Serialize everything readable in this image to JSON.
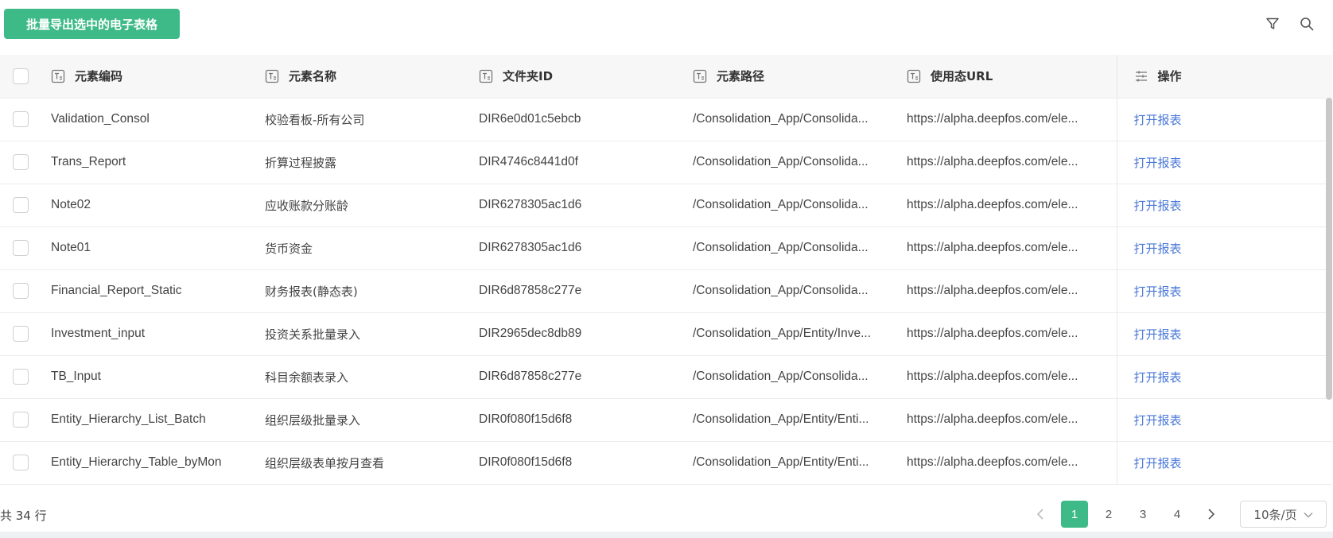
{
  "toolbar": {
    "export_label": "批量导出选中的电子表格",
    "filter_icon": "filter-icon",
    "search_icon": "search-icon"
  },
  "table": {
    "columns": [
      {
        "label": "元素编码",
        "icon": "text-column-icon"
      },
      {
        "label": "元素名称",
        "icon": "text-column-icon"
      },
      {
        "label": "文件夹ID",
        "icon": "text-column-icon"
      },
      {
        "label": "元素路径",
        "icon": "text-column-icon"
      },
      {
        "label": "使用态URL",
        "icon": "text-column-icon"
      },
      {
        "label": "操作",
        "icon": "settings-sliders-icon"
      }
    ],
    "rows": [
      {
        "code": "Validation_Consol",
        "name": "校验看板-所有公司",
        "folder": "DIR6e0d01c5ebcb",
        "path": "/Consolidation_App/Consolida...",
        "url": "https://alpha.deepfos.com/ele...",
        "action": "打开报表"
      },
      {
        "code": "Trans_Report",
        "name": "折算过程披露",
        "folder": "DIR4746c8441d0f",
        "path": "/Consolidation_App/Consolida...",
        "url": "https://alpha.deepfos.com/ele...",
        "action": "打开报表"
      },
      {
        "code": "Note02",
        "name": "应收账款分账龄",
        "folder": "DIR6278305ac1d6",
        "path": "/Consolidation_App/Consolida...",
        "url": "https://alpha.deepfos.com/ele...",
        "action": "打开报表"
      },
      {
        "code": "Note01",
        "name": "货币资金",
        "folder": "DIR6278305ac1d6",
        "path": "/Consolidation_App/Consolida...",
        "url": "https://alpha.deepfos.com/ele...",
        "action": "打开报表"
      },
      {
        "code": "Financial_Report_Static",
        "name": "财务报表(静态表)",
        "folder": "DIR6d87858c277e",
        "path": "/Consolidation_App/Consolida...",
        "url": "https://alpha.deepfos.com/ele...",
        "action": "打开报表"
      },
      {
        "code": "Investment_input",
        "name": "投资关系批量录入",
        "folder": "DIR2965dec8db89",
        "path": "/Consolidation_App/Entity/Inve...",
        "url": "https://alpha.deepfos.com/ele...",
        "action": "打开报表"
      },
      {
        "code": "TB_Input",
        "name": "科目余额表录入",
        "folder": "DIR6d87858c277e",
        "path": "/Consolidation_App/Consolida...",
        "url": "https://alpha.deepfos.com/ele...",
        "action": "打开报表"
      },
      {
        "code": "Entity_Hierarchy_List_Batch",
        "name": "组织层级批量录入",
        "folder": "DIR0f080f15d6f8",
        "path": "/Consolidation_App/Entity/Enti...",
        "url": "https://alpha.deepfos.com/ele...",
        "action": "打开报表"
      },
      {
        "code": "Entity_Hierarchy_Table_byMon",
        "name": "组织层级表单按月查看",
        "folder": "DIR0f080f15d6f8",
        "path": "/Consolidation_App/Entity/Enti...",
        "url": "https://alpha.deepfos.com/ele...",
        "action": "打开报表"
      }
    ]
  },
  "footer": {
    "total": "共 34 行",
    "pages": [
      "1",
      "2",
      "3",
      "4"
    ],
    "current_page": "1",
    "page_size": "10条/页"
  },
  "colors": {
    "accent": "#3dba87",
    "link": "#4a78d8"
  }
}
